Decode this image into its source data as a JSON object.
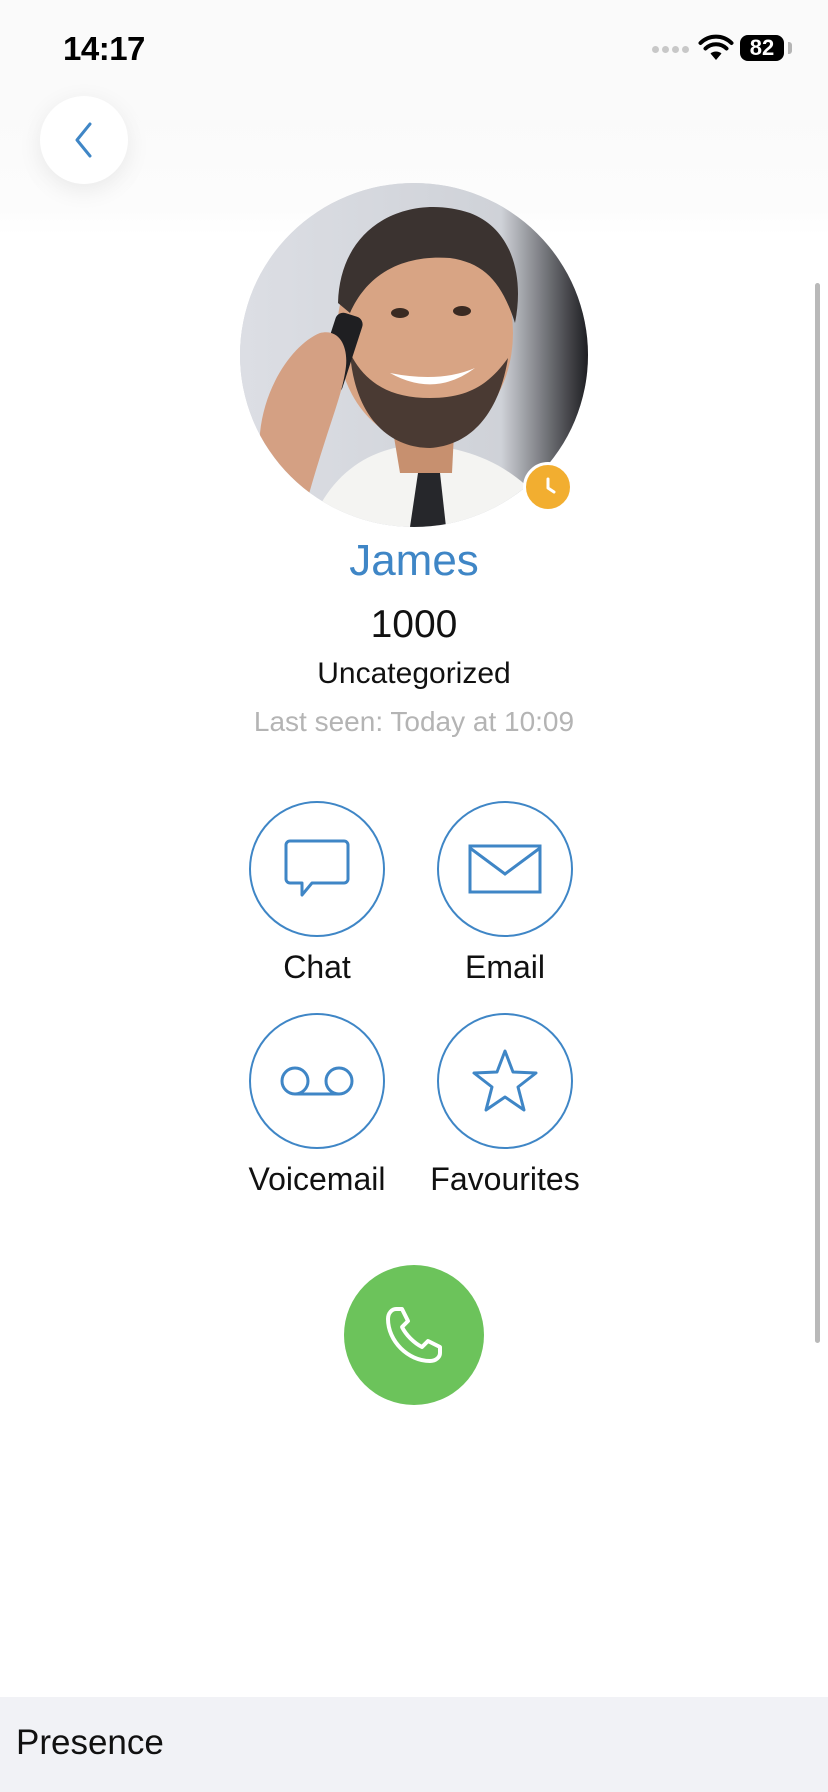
{
  "status_bar": {
    "time": "14:17",
    "battery": "82"
  },
  "contact": {
    "name": "James",
    "extension": "1000",
    "category": "Uncategorized",
    "last_seen": "Last seen: Today at 10:09",
    "presence_color": "#f2ae30"
  },
  "actions": [
    {
      "label": "Chat",
      "icon": "chat-bubble-icon"
    },
    {
      "label": "Email",
      "icon": "envelope-icon"
    },
    {
      "label": "Voicemail",
      "icon": "voicemail-icon"
    },
    {
      "label": "Favourites",
      "icon": "star-icon"
    }
  ],
  "call": {
    "icon": "phone-icon",
    "color": "#6cc35b"
  },
  "section": {
    "title": "Presence"
  },
  "colors": {
    "accent": "#3f86c6",
    "background": "#ffffff",
    "section_bg": "#f1f2f6"
  }
}
